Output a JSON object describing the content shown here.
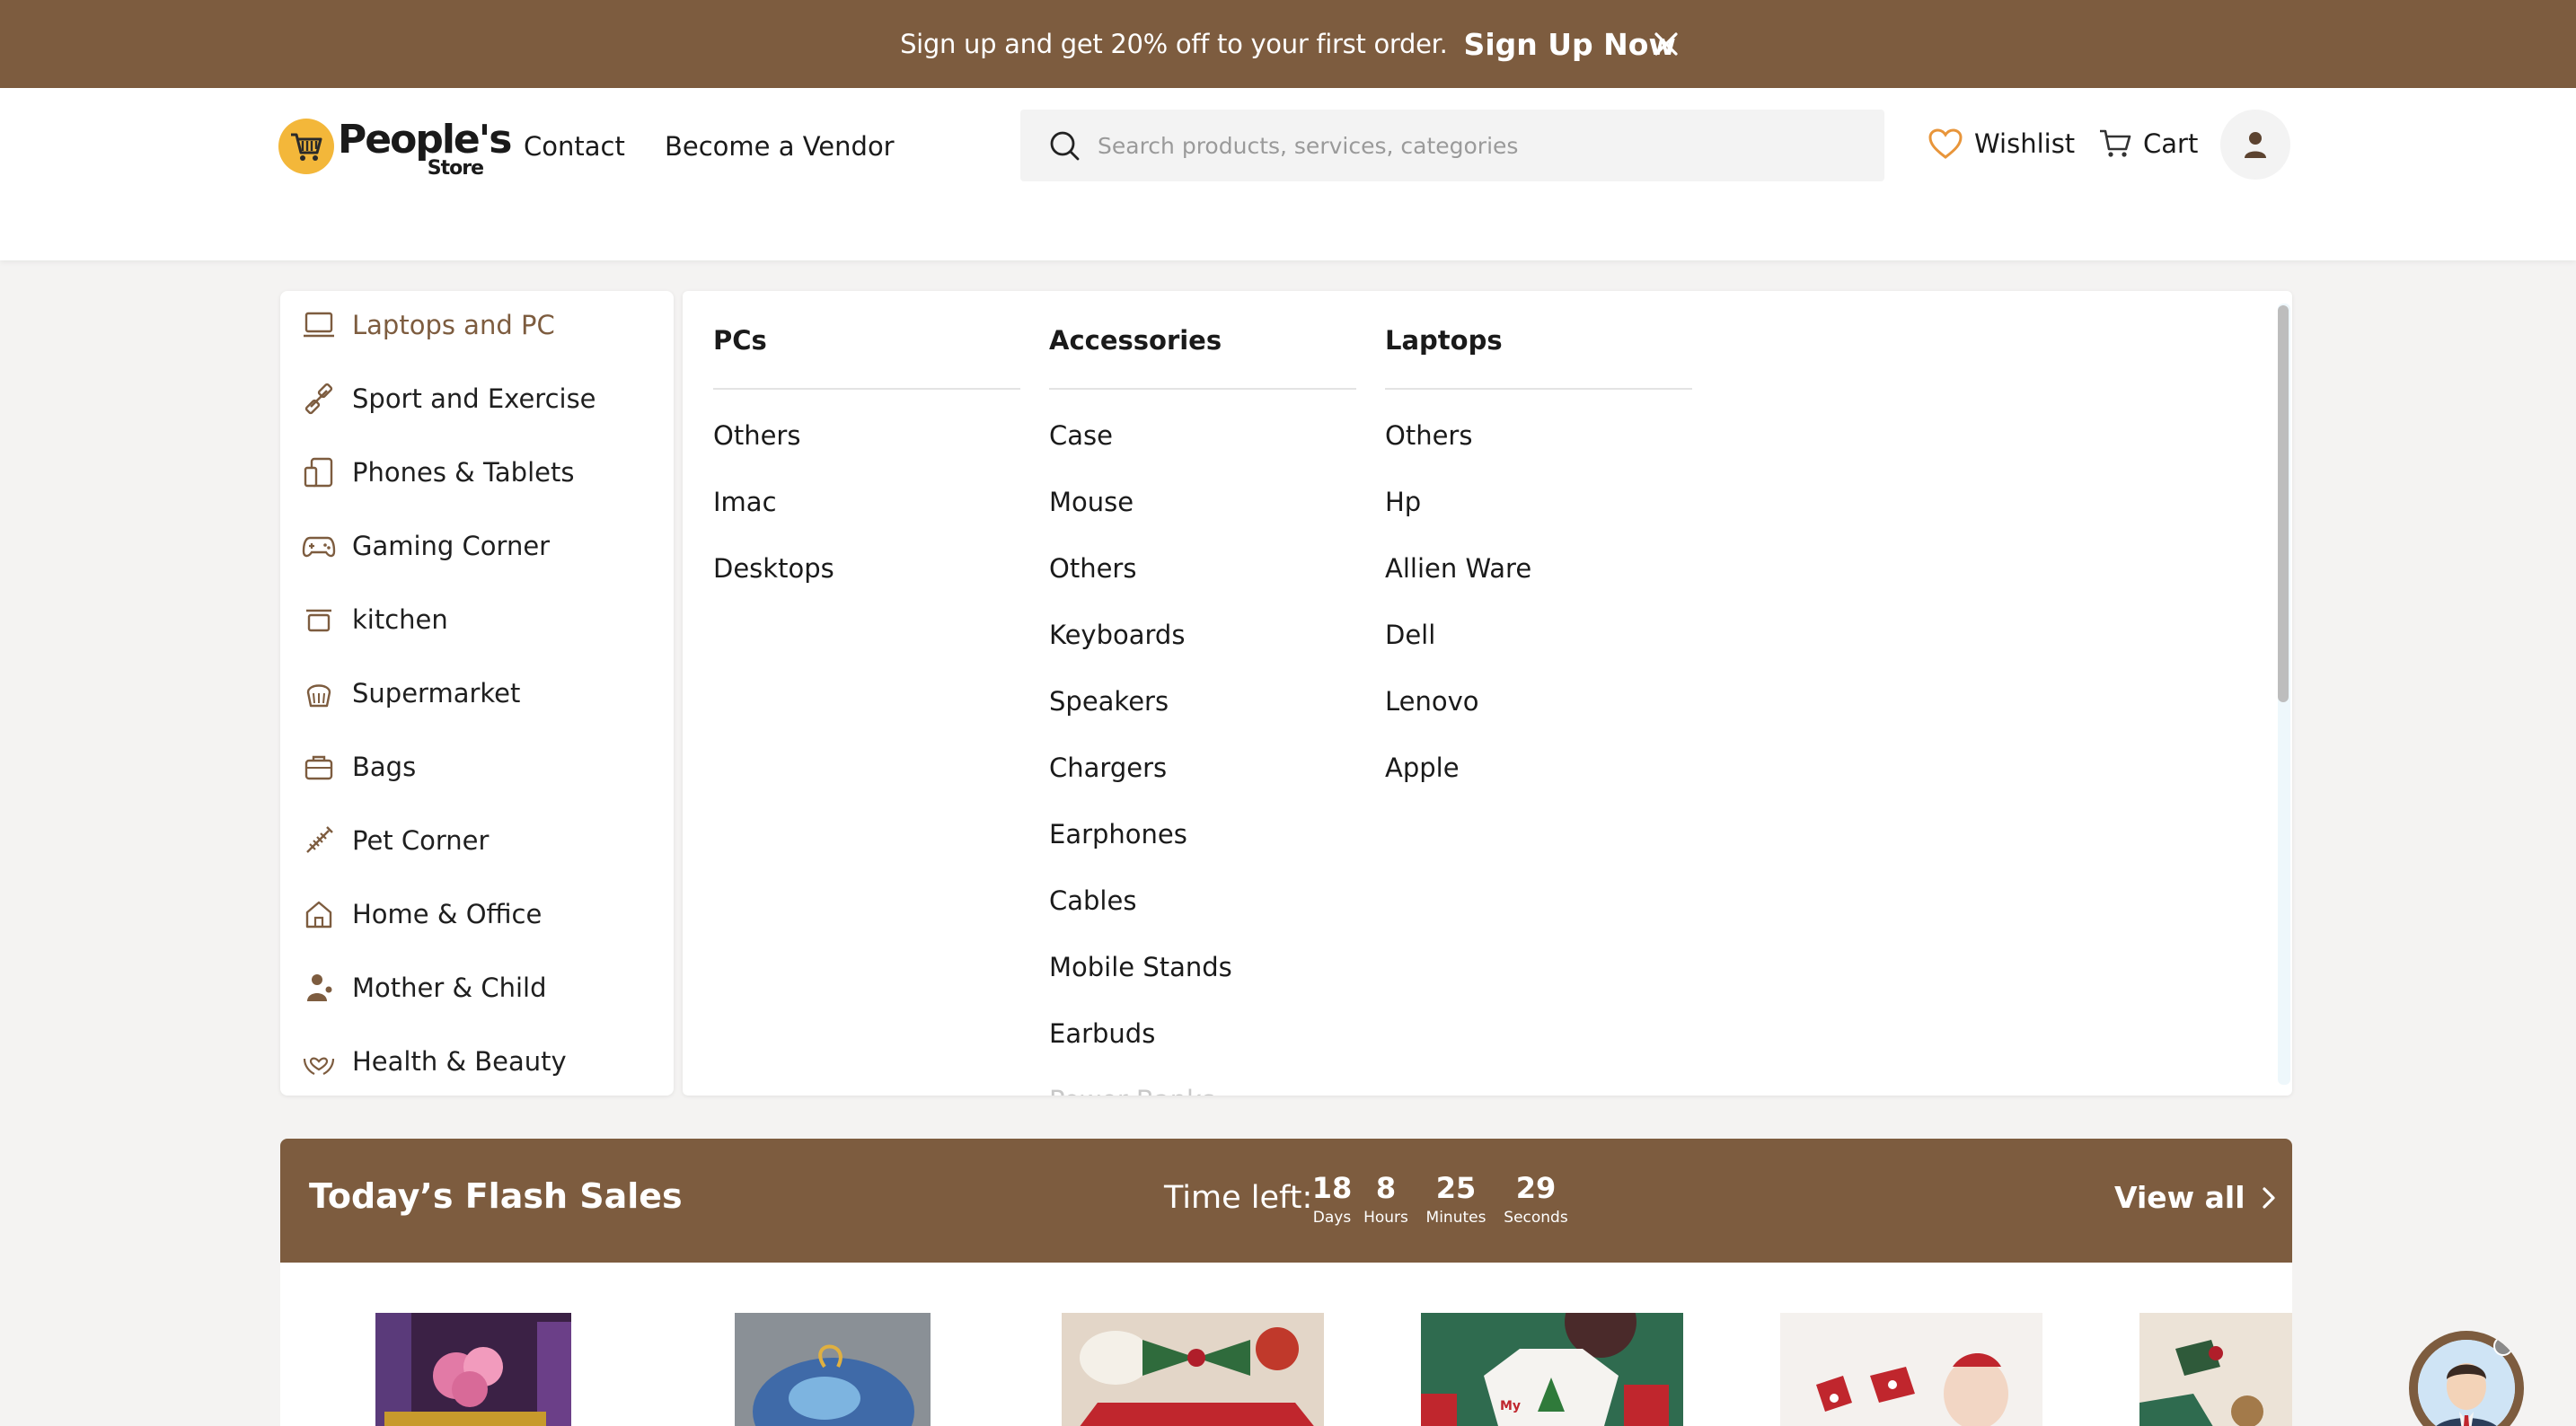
{
  "promo": {
    "message": "Sign up and get 20% off to your first order.",
    "cta": "Sign Up Now",
    "close_icon": "close-icon"
  },
  "header": {
    "logo_word": "People's",
    "logo_sub": "Store",
    "nav": [
      "Contact",
      "Become a Vendor"
    ],
    "search_placeholder": "Search products, services, categories",
    "wishlist": "Wishlist",
    "cart": "Cart",
    "accent": "#7d5c3f",
    "wishlist_icon_color": "#e8953a"
  },
  "categories": [
    {
      "label": "Laptops and PC",
      "icon": "laptop-icon",
      "active": true
    },
    {
      "label": "Sport and Exercise",
      "icon": "dumbbell-icon"
    },
    {
      "label": "Phones & Tablets",
      "icon": "devices-icon"
    },
    {
      "label": "Gaming Corner",
      "icon": "gamepad-icon"
    },
    {
      "label": "kitchen",
      "icon": "pot-icon"
    },
    {
      "label": "Supermarket",
      "icon": "basket-icon"
    },
    {
      "label": "Bags",
      "icon": "bag-icon"
    },
    {
      "label": "Pet Corner",
      "icon": "pet-icon"
    },
    {
      "label": "Home & Office",
      "icon": "home-icon"
    },
    {
      "label": "Mother & Child",
      "icon": "mother-child-icon"
    },
    {
      "label": "Health & Beauty",
      "icon": "health-icon"
    }
  ],
  "mega": {
    "columns": [
      {
        "heading": "PCs",
        "links": [
          "Others",
          "Imac",
          "Desktops"
        ]
      },
      {
        "heading": "Accessories",
        "links": [
          "Case",
          "Mouse",
          "Others",
          "Keyboards",
          "Speakers",
          "Chargers",
          "Earphones",
          "Cables",
          "Mobile Stands",
          "Earbuds",
          "Power Banks"
        ]
      },
      {
        "heading": "Laptops",
        "links": [
          "Others",
          "Hp",
          "Allien Ware",
          "Dell",
          "Lenovo",
          "Apple"
        ]
      }
    ]
  },
  "flash": {
    "title": "Today’s Flash Sales",
    "time_left": "Time left:",
    "countdown": [
      {
        "value": "18",
        "unit": "Days"
      },
      {
        "value": "8",
        "unit": "Hours"
      },
      {
        "value": "25",
        "unit": "Minutes"
      },
      {
        "value": "29",
        "unit": "Seconds"
      }
    ],
    "view_all": "View all"
  }
}
